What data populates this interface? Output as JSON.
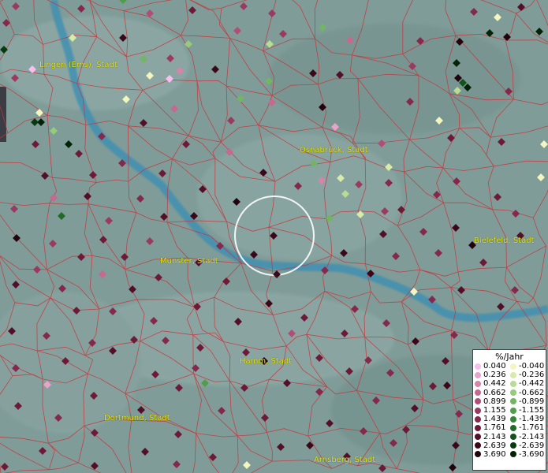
{
  "map": {
    "cities": [
      {
        "id": "lingen",
        "label": "Lingen (Ems), Stadt"
      },
      {
        "id": "osnabrueck",
        "label": "Osnabrück, Stadt"
      },
      {
        "id": "muenster",
        "label": "Münster, Stadt"
      },
      {
        "id": "bielefeld",
        "label": "Bielefeld, Stadt"
      },
      {
        "id": "hamm",
        "label": "Hamm, Stadt"
      },
      {
        "id": "dortmund",
        "label": "Dortmund, Stadt"
      },
      {
        "id": "arnsberg",
        "label": "Arnsberg, Stadt"
      }
    ]
  },
  "legend": {
    "title": "%/Jahr",
    "positive": [
      {
        "label": "0.040",
        "color": "#f6bff0"
      },
      {
        "label": "0.236",
        "color": "#e9a3cb"
      },
      {
        "label": "0.442",
        "color": "#d884aa"
      },
      {
        "label": "0.662",
        "color": "#c66890"
      },
      {
        "label": "0.899",
        "color": "#b14e77"
      },
      {
        "label": "1.155",
        "color": "#9a3a60"
      },
      {
        "label": "1.439",
        "color": "#84284c"
      },
      {
        "label": "1.761",
        "color": "#6c1a38"
      },
      {
        "label": "2.143",
        "color": "#520f27"
      },
      {
        "label": "2.639",
        "color": "#3a0819"
      },
      {
        "label": "3.690",
        "color": "#22030d"
      }
    ],
    "negative": [
      {
        "label": "-0.040",
        "color": "#f4f6c0"
      },
      {
        "label": "-0.236",
        "color": "#d8eca9"
      },
      {
        "label": "-0.442",
        "color": "#b8dd92"
      },
      {
        "label": "-0.662",
        "color": "#95cb7a"
      },
      {
        "label": "-0.899",
        "color": "#72b563"
      },
      {
        "label": "-1.155",
        "color": "#529c4c"
      },
      {
        "label": "-1.439",
        "color": "#378338"
      },
      {
        "label": "-1.761",
        "color": "#226a28"
      },
      {
        "label": "-2.143",
        "color": "#13521b"
      },
      {
        "label": "-2.639",
        "color": "#083a10"
      },
      {
        "label": "-3.690",
        "color": "#022307"
      }
    ]
  }
}
